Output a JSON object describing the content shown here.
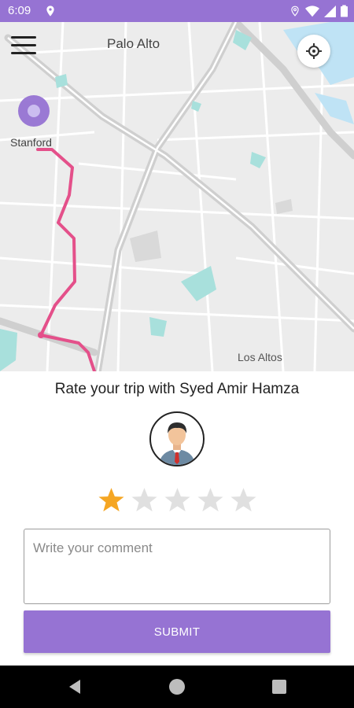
{
  "status_bar": {
    "time": "6:09",
    "icons": [
      "location-pin-icon",
      "wifi-icon",
      "signal-icon",
      "battery-icon"
    ]
  },
  "map": {
    "labels": {
      "palo_alto": "Palo Alto",
      "stanford": "Stanford",
      "los_altos": "Los Altos"
    },
    "route_color": "#e4508a",
    "pin_color": "#9673d3"
  },
  "rating": {
    "title": "Rate your trip with Syed Amir Hamza",
    "selected_stars": 1,
    "max_stars": 5,
    "star_active_color": "#f5a623",
    "star_inactive_color": "#e0e0e0"
  },
  "comment": {
    "placeholder": "Write your comment",
    "value": ""
  },
  "submit": {
    "label": "SUBMIT",
    "color": "#9673d3"
  },
  "nav_bar": {
    "buttons": [
      "back-icon",
      "home-icon",
      "recents-icon"
    ]
  }
}
